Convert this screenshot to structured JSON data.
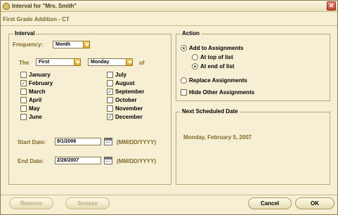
{
  "window": {
    "title": "Interval for \"Mrs. Smith\"",
    "close_glyph": "✕"
  },
  "subtitle": "First Grade Addition - CT",
  "interval": {
    "section_title": "Interval",
    "frequency_label": "Frequency:",
    "frequency_value": "Month",
    "the_label": "The",
    "ordinal_value": "First",
    "weekday_value": "Monday",
    "of_label": "of",
    "months": [
      {
        "label": "January",
        "checked": false
      },
      {
        "label": "February",
        "checked": true
      },
      {
        "label": "March",
        "checked": false
      },
      {
        "label": "April",
        "checked": false
      },
      {
        "label": "May",
        "checked": false
      },
      {
        "label": "June",
        "checked": false
      },
      {
        "label": "July",
        "checked": false
      },
      {
        "label": "August",
        "checked": false
      },
      {
        "label": "September",
        "checked": true
      },
      {
        "label": "October",
        "checked": false
      },
      {
        "label": "November",
        "checked": false
      },
      {
        "label": "December",
        "checked": true
      }
    ],
    "start_date_label": "Start Date:",
    "start_date_value": "9/1/2006",
    "end_date_label": "End Date:",
    "end_date_value": "2/28/2007",
    "date_format": "(MM/DD/YYYY)"
  },
  "action": {
    "section_title": "Action",
    "add_label": "Add to Assignments",
    "top_label": "At top of list",
    "end_label": "At end of list",
    "replace_label": "Replace Assignments",
    "hide_label": "Hide Other Assignments",
    "add_checked": true,
    "top_checked": false,
    "end_checked": true,
    "replace_checked": false,
    "hide_checked": false
  },
  "next": {
    "section_title": "Next Scheduled Date",
    "value": "Monday, February 5, 2007"
  },
  "buttons": {
    "remove": "Remove",
    "snooze": "Snooze",
    "cancel": "Cancel",
    "ok": "OK"
  },
  "check_glyph": "✓"
}
